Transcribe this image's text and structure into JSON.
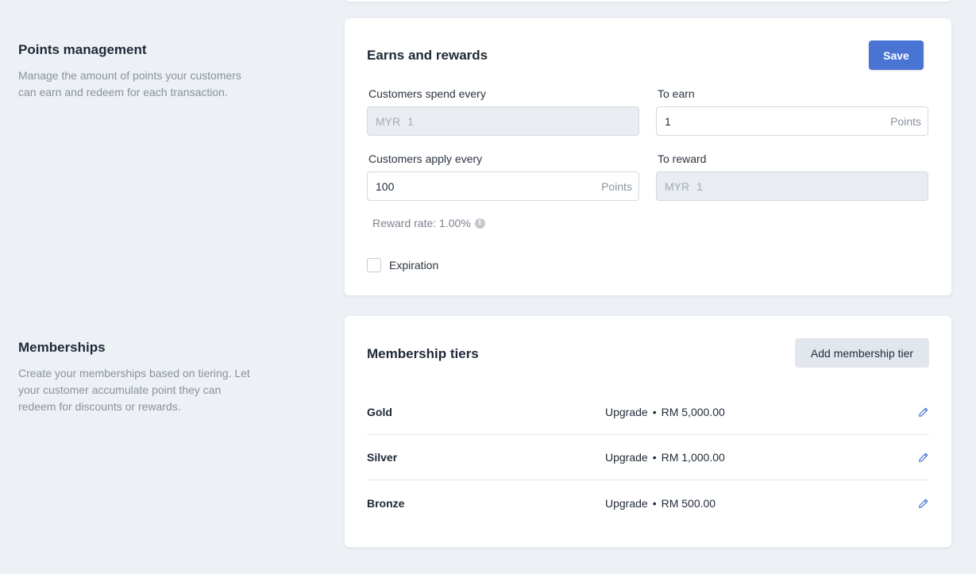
{
  "points_section": {
    "title": "Points management",
    "description": "Manage the amount of points your customers can earn and redeem for each transaction."
  },
  "earns_card": {
    "title": "Earns and rewards",
    "save_label": "Save",
    "spend": {
      "label": "Customers spend every",
      "prefix": "MYR",
      "value": "1"
    },
    "earn": {
      "label": "To earn",
      "value": "1",
      "suffix": "Points"
    },
    "apply": {
      "label": "Customers apply every",
      "value": "100",
      "suffix": "Points"
    },
    "reward": {
      "label": "To reward",
      "prefix": "MYR",
      "value": "1"
    },
    "reward_rate": "Reward rate: 1.00%",
    "expiration_label": "Expiration"
  },
  "memberships_section": {
    "title": "Memberships",
    "description": "Create your memberships based on tiering. Let your customer accumulate point they can redeem for discounts or rewards."
  },
  "tiers_card": {
    "title": "Membership tiers",
    "add_label": "Add membership tier",
    "tiers": [
      {
        "name": "Gold",
        "action": "Upgrade",
        "separator": "•",
        "amount": "RM 5,000.00"
      },
      {
        "name": "Silver",
        "action": "Upgrade",
        "separator": "•",
        "amount": "RM 1,000.00"
      },
      {
        "name": "Bronze",
        "action": "Upgrade",
        "separator": "•",
        "amount": "RM 500.00"
      }
    ]
  },
  "colors": {
    "background": "#edf1f5",
    "primary": "#4a74d3",
    "edit_icon": "#4a74d3"
  }
}
